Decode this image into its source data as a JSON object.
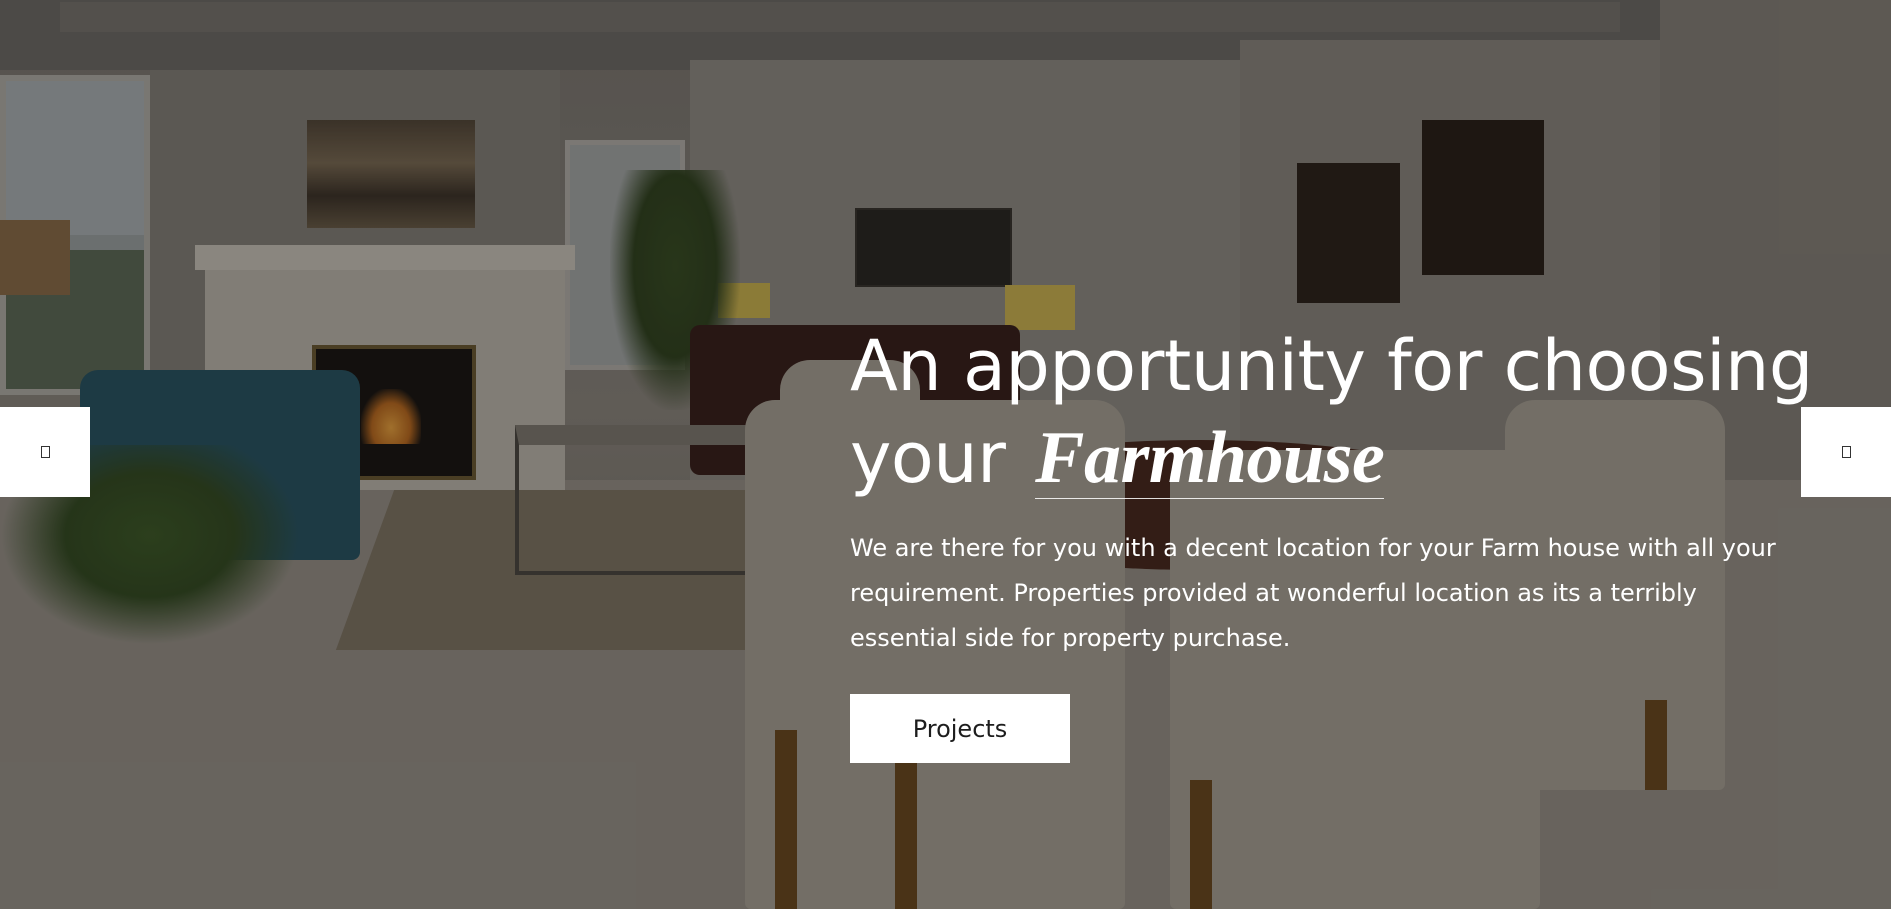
{
  "hero": {
    "headline_line1": "An apportunity for choosing",
    "headline_line2_prefix": "your",
    "headline_accent": "Farmhouse",
    "description": "We are there for you with a decent location for your Farm house with all your requirement. Properties provided at wonderful location as its a terribly essential side for property purchase.",
    "cta_label": "Projects"
  },
  "slider": {
    "prev_icon": "prev-arrow-icon",
    "next_icon": "next-arrow-icon"
  },
  "colors": {
    "overlay": "#000000",
    "text": "#ffffff",
    "button_bg": "#ffffff",
    "button_text": "#1d1d1d"
  }
}
